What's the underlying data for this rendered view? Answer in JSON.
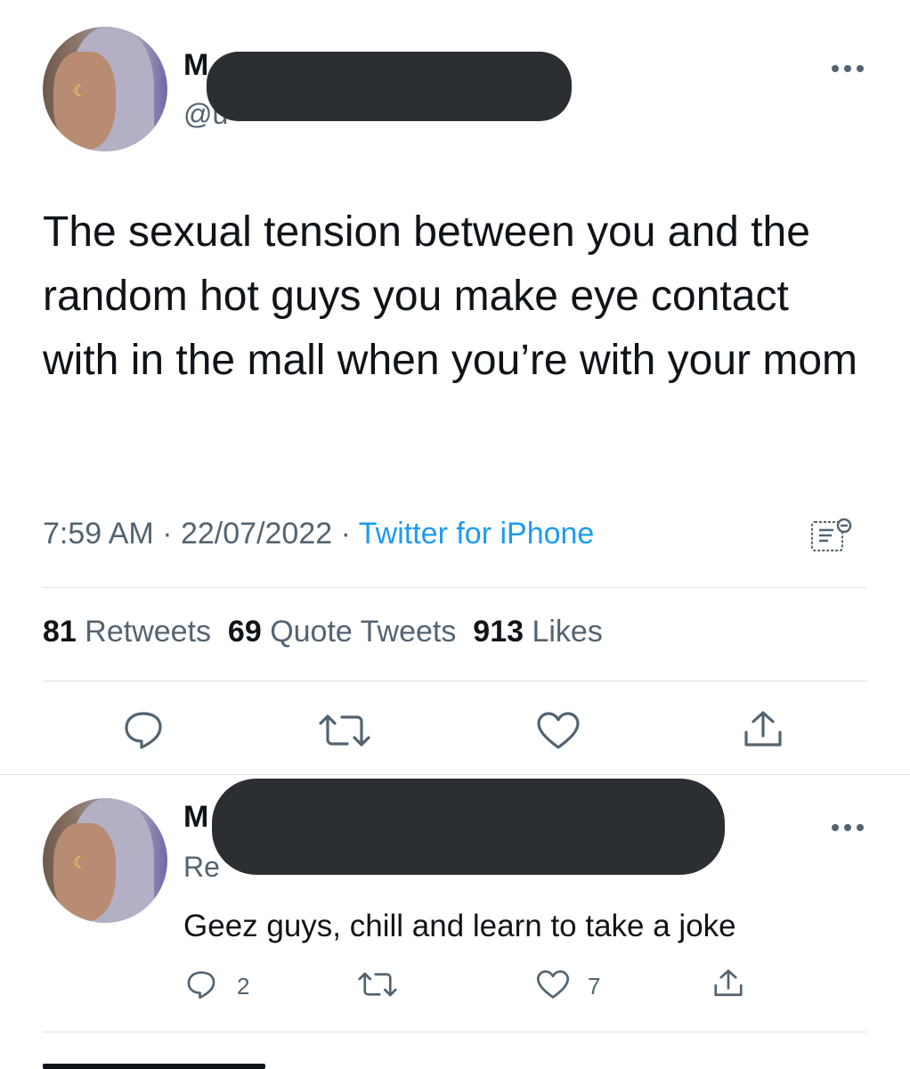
{
  "tweet": {
    "author_initial": "M",
    "handle_partial": "@u",
    "text": "The sexual tension between you and the random hot guys you make eye contact with in the mall when you’re with your mom",
    "time": "7:59 AM",
    "date": "22/07/2022",
    "source": "Twitter for iPhone",
    "separator": "·",
    "stats": {
      "retweets_count": "81",
      "retweets_label": "Retweets",
      "quotes_count": "69",
      "quotes_label": "Quote Tweets",
      "likes_count": "913",
      "likes_label": "Likes"
    }
  },
  "reply": {
    "author_initial": "M",
    "replying_partial": "Re",
    "text": "Geez guys, chill and learn to take a joke",
    "reply_count": "2",
    "like_count": "7"
  },
  "icons": {
    "more": "more-horizontal-icon",
    "analytics": "analytics-icon",
    "reply": "reply-icon",
    "retweet": "retweet-icon",
    "like": "heart-icon",
    "share": "share-icon"
  },
  "colors": {
    "link": "#1d9bf0",
    "muted": "#536471",
    "redaction": "#2b2f33"
  }
}
